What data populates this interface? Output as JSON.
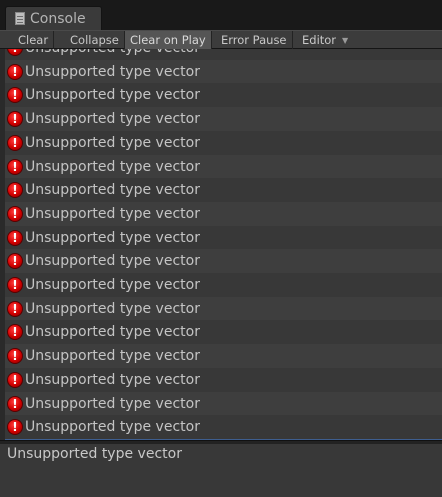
{
  "window": {
    "tab_title": "Console"
  },
  "toolbar": {
    "clear_label": "Clear",
    "collapse_label": "Collapse",
    "clear_on_play_label": "Clear on Play",
    "error_pause_label": "Error Pause",
    "editor_label": "Editor",
    "editor_dropdown_glyph": "▼"
  },
  "log": {
    "error_glyph": "!",
    "entries": [
      "Unsupported type vector",
      "Unsupported type vector",
      "Unsupported type vector",
      "Unsupported type vector",
      "Unsupported type vector",
      "Unsupported type vector",
      "Unsupported type vector",
      "Unsupported type vector",
      "Unsupported type vector",
      "Unsupported type vector",
      "Unsupported type vector",
      "Unsupported type vector",
      "Unsupported type vector",
      "Unsupported type vector",
      "Unsupported type vector",
      "Unsupported type vector",
      "Unsupported type vector",
      "Unsupported type vector"
    ],
    "selected_index": 17
  },
  "detail": {
    "message": "Unsupported type vector"
  },
  "colors": {
    "selection": "#3e5e8f",
    "error_red": "#d20000"
  }
}
